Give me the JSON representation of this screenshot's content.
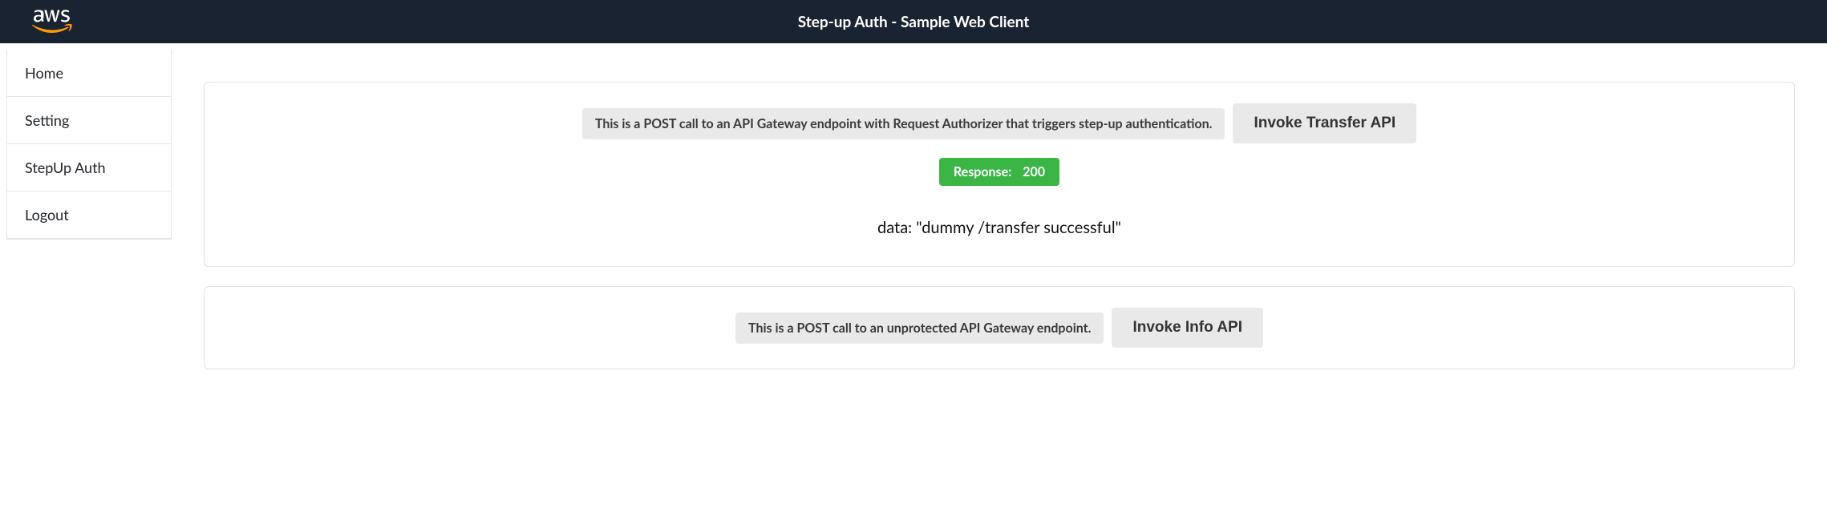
{
  "header": {
    "title": "Step-up Auth - Sample Web Client"
  },
  "sidebar": {
    "items": [
      {
        "label": "Home"
      },
      {
        "label": "Setting"
      },
      {
        "label": "StepUp Auth"
      },
      {
        "label": "Logout"
      }
    ]
  },
  "main": {
    "cards": [
      {
        "description": "This is a POST call to an API Gateway endpoint with Request Authorizer that triggers step-up authentication.",
        "button_label": "Invoke Transfer API",
        "response": {
          "label": "Response:",
          "code": "200",
          "data_text": "data: \"dummy /transfer successful\""
        }
      },
      {
        "description": "This is a POST call to an unprotected API Gateway endpoint.",
        "button_label": "Invoke Info API"
      }
    ]
  }
}
